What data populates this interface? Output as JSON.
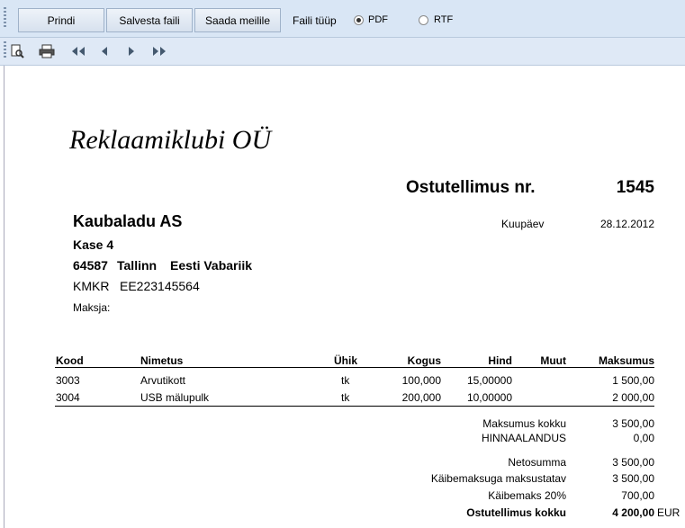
{
  "toolbar": {
    "print_label": "Prindi",
    "save_label": "Salvesta faili",
    "email_label": "Saada meilile",
    "filetype_label": "Faili tüüp",
    "option_pdf": "PDF",
    "option_rtf": "RTF",
    "selected_filetype": "PDF"
  },
  "document": {
    "company_name": "Reklaamiklubi OÜ",
    "doc_title": "Ostutellimus nr.",
    "doc_number": "1545",
    "supplier_name": "Kaubaladu AS",
    "street": "Kase 4",
    "postal": "64587",
    "city": "Tallinn",
    "country": "Eesti Vabariik",
    "kmkr_label": "KMKR",
    "kmkr_value": "EE223145564",
    "payer_label": "Maksja:",
    "date_label": "Kuupäev",
    "date_value": "28.12.2012"
  },
  "table": {
    "headers": [
      "Kood",
      "Nimetus",
      "Ühik",
      "Kogus",
      "Hind",
      "Muut",
      "Maksumus"
    ],
    "rows": [
      {
        "kood": "3003",
        "nimetus": "Arvutikott",
        "uhik": "tk",
        "kogus": "100,000",
        "hind": "15,00000",
        "muut": "",
        "maksumus": "1 500,00"
      },
      {
        "kood": "3004",
        "nimetus": "USB mälupulk",
        "uhik": "tk",
        "kogus": "200,000",
        "hind": "10,00000",
        "muut": "",
        "maksumus": "2 000,00"
      }
    ]
  },
  "totals": {
    "maksumus_label": "Maksumus kokku",
    "maksumus_value": "3 500,00",
    "allahindlus_label": "HINNAALANDUS",
    "allahindlus_value": "0,00",
    "neto_label": "Netosumma",
    "neto_value": "3 500,00",
    "kaibemaksustatav_label": "Käibemaksuga maksustatav",
    "kaibemaksustatav_value": "3 500,00",
    "kaibemaks_label": "Käibemaks 20%",
    "kaibemaks_value": "700,00",
    "kokku_label": "Ostutellimus kokku",
    "kokku_value": "4 200,00",
    "currency": "EUR"
  }
}
